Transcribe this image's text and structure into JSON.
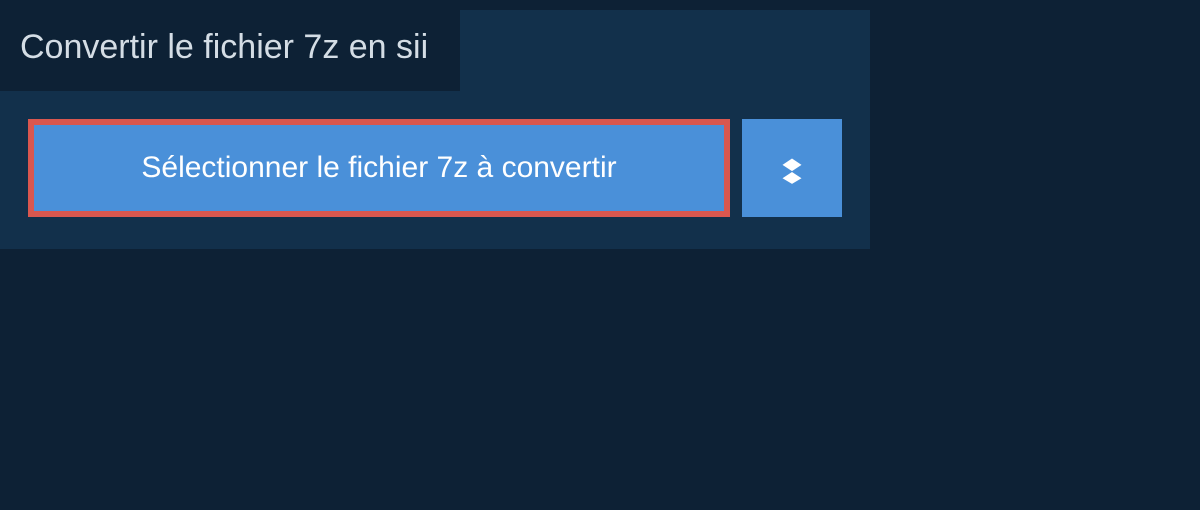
{
  "header": {
    "title": "Convertir le fichier 7z en sii"
  },
  "upload": {
    "select_button_label": "Sélectionner le fichier 7z à convertir"
  }
}
